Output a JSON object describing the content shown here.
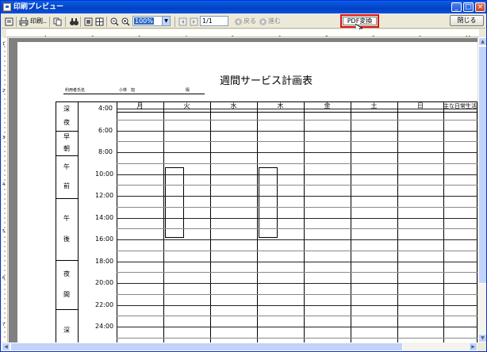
{
  "window": {
    "title": "印刷プレビュー",
    "controls": {
      "minimize": "_",
      "maximize": "□",
      "close": "×"
    }
  },
  "toolbar": {
    "print_label": "印刷..",
    "zoom_value": "100%",
    "page_value": "1/1",
    "prev_label": "戻る",
    "next_label": "進む",
    "pdf_label": "PDF変換",
    "close_label": "閉じる"
  },
  "ruler": {
    "h_numbers": [
      "1",
      "2",
      "3",
      "4",
      "5",
      "6",
      "7",
      "8",
      "9",
      "10"
    ],
    "v_numbers": [
      "1",
      "2",
      "3",
      "4",
      "5",
      "6",
      "7"
    ]
  },
  "document": {
    "title": "週間サービス計画表",
    "user_label": "利用者氏名",
    "user_name": "小林　旭",
    "user_suffix": "殿",
    "days": [
      "月",
      "火",
      "水",
      "木",
      "金",
      "土",
      "日",
      "主な日常生活上"
    ],
    "times": [
      "4:00",
      "6:00",
      "8:00",
      "10:00",
      "12:00",
      "14:00",
      "16:00",
      "18:00",
      "20:00",
      "22:00",
      "24:00"
    ],
    "periods": [
      [
        "深",
        "夜"
      ],
      [
        "早",
        "朝"
      ],
      [
        "午",
        "前"
      ],
      [
        "午",
        "後"
      ],
      [
        "夜",
        "間"
      ],
      [
        "深"
      ]
    ]
  },
  "icons": [
    "print-setup-icon",
    "printer-icon",
    "copy-icon",
    "binoculars-icon",
    "single-page-icon",
    "four-pages-icon",
    "zoom-out-icon",
    "zoom-in-icon",
    "first-page-icon",
    "prev-page-icon",
    "back-circle-icon",
    "forward-circle-icon",
    "mouse-cursor-icon"
  ]
}
